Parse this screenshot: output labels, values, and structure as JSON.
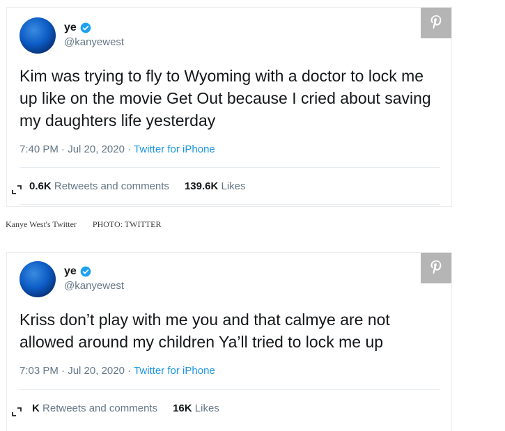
{
  "tweets": [
    {
      "name": "ye",
      "handle": "@kanyewest",
      "text": "Kim was trying to fly to Wyoming with a doctor to lock me up like on the movie Get Out because I cried about saving my daughters life yesterday",
      "time": "7:40 PM",
      "date": "Jul 20, 2020",
      "source": "Twitter for iPhone",
      "retweets_count": "0.6K",
      "retweets_label": "Retweets and comments",
      "likes_count": "139.6K",
      "likes_label": "Likes"
    },
    {
      "name": "ye",
      "handle": "@kanyewest",
      "text": "Kriss don’t play with me  you and that calmye are not allowed around my children   Ya’ll tried to lock me up",
      "time": "7:03 PM",
      "date": "Jul 20, 2020",
      "source": "Twitter for iPhone",
      "retweets_count": "K",
      "retweets_label": "Retweets and comments",
      "likes_count": "16K",
      "likes_label": "Likes"
    }
  ],
  "caption": {
    "text": "Kanye West's Twitter",
    "credit": "PHOTO: TWITTER"
  },
  "colors": {
    "link": "#1b95e0",
    "muted": "#657786",
    "pin_bg": "#b5b5b5",
    "verified": "#1da1f2"
  },
  "icons": [
    "pinterest-icon",
    "verified-badge-icon",
    "expand-icon"
  ],
  "separator": "·"
}
